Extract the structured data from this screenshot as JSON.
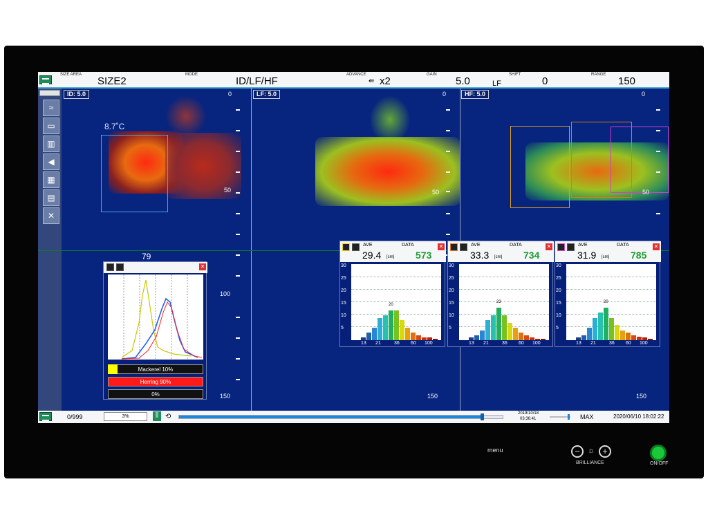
{
  "topbar": {
    "size_area_label": "SIZE AREA",
    "size_area_value": "SIZE2",
    "mode_label": "MODE",
    "mode_value": "ID/LF/HF",
    "advance_label": "ADVANCE",
    "advance_value": "x2",
    "gain_label": "GAIN",
    "gain_value": "5.0",
    "gain_freq": "LF",
    "shift_label": "SHIFT",
    "shift_value": "0",
    "range_label": "RANGE",
    "range_value": "150"
  },
  "panels": {
    "id": {
      "tag": "ID: 5.0",
      "surface": "0",
      "temperature": "8.7˚C"
    },
    "lf": {
      "tag": "LF: 5.0",
      "surface": "0"
    },
    "hf": {
      "tag": "HF: 5.0",
      "surface": "0"
    },
    "depth_50": "50",
    "depth_100": "100",
    "depth_150": "150"
  },
  "species_popup": {
    "top_value": "79",
    "row1": "Mackerel 10%",
    "row2": "Herring 90%",
    "row3": "0%",
    "row1_color": "#ffff00",
    "row2_color": "#ff1a1a"
  },
  "histograms": [
    {
      "ave_label": "AVE",
      "ave": "29.4",
      "unit": "[cm]",
      "data_label": "DATA",
      "data": "573",
      "peak_label": "20",
      "icon_color": "#f5d000",
      "yticks": [
        "30",
        "25",
        "20",
        "15",
        "10",
        "5"
      ],
      "xticks": [
        "13",
        "21",
        "36",
        "60",
        "100"
      ],
      "values": [
        1,
        3,
        5,
        9,
        10,
        12,
        12,
        8,
        5,
        3,
        2,
        1,
        1,
        0.5
      ]
    },
    {
      "ave_label": "AVE",
      "ave": "33.3",
      "unit": "[cm]",
      "data_label": "DATA",
      "data": "734",
      "peak_label": "23",
      "icon_color": "#e07818",
      "yticks": [
        "30",
        "25",
        "20",
        "15",
        "10",
        "5"
      ],
      "xticks": [
        "13",
        "21",
        "36",
        "60",
        "100"
      ],
      "values": [
        1,
        2,
        4,
        8,
        10,
        13,
        10,
        7,
        5,
        3,
        2,
        1,
        0.5,
        0.5
      ]
    },
    {
      "ave_label": "AVE",
      "ave": "31.9",
      "unit": "[cm]",
      "data_label": "DATA",
      "data": "785",
      "peak_label": "20",
      "icon_color": "#e040e0",
      "yticks": [
        "30",
        "25",
        "20",
        "15",
        "10",
        "5"
      ],
      "xticks": [
        "13",
        "21",
        "36",
        "60",
        "100"
      ],
      "values": [
        1,
        2,
        5,
        9,
        11,
        13,
        9,
        6,
        4,
        3,
        2,
        1.5,
        1,
        0.5
      ]
    }
  ],
  "bottombar": {
    "count": "0/999",
    "percent": "3%",
    "date": "2019/10/18",
    "time": "03:36:41",
    "max_label": "MAX",
    "datetime": "2020/06/10 18:02:22",
    "slider_progress": 0.94
  },
  "hardware": {
    "menu_label": "menu",
    "brilliance_label": "BRILLIANCE",
    "onoff_label": "ON/OFF"
  }
}
